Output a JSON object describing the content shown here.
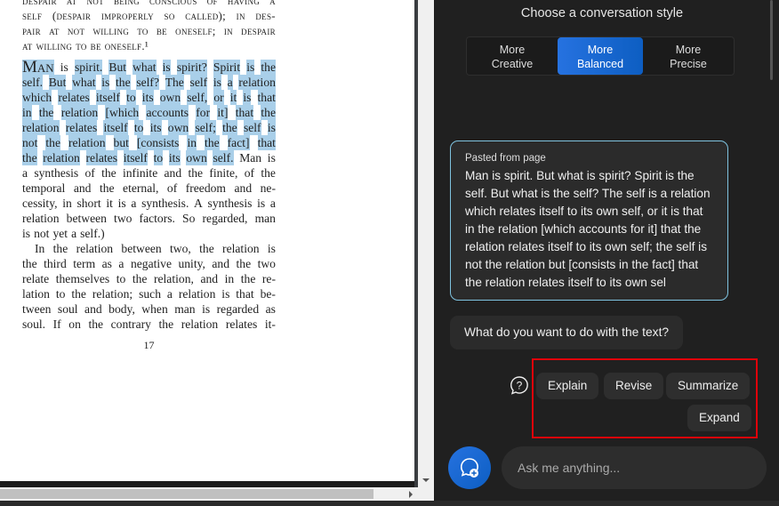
{
  "document": {
    "header_lines": [
      "despair at not being conscious of having a",
      "self (despair improperly so called); in des-",
      "pair at not willing to be oneself; in despair",
      "at willing to be oneself.¹"
    ],
    "para1": [
      [
        {
          "t": "Man",
          "hl": true,
          "cap": true
        },
        {
          "t": "is"
        },
        {
          "t": "spirit.",
          "hl": true
        },
        {
          "t": "But what is spirit? Spirit is the",
          "hl": true
        }
      ],
      [
        {
          "t": "self. But what is the self? The self is a relation",
          "hl": true
        }
      ],
      [
        {
          "t": "which relates itself to its own self, or it is that",
          "hl": true
        }
      ],
      [
        {
          "t": "in the relation [which accounts for it] that the",
          "hl": true
        }
      ],
      [
        {
          "t": "relation relates itself to its own self; the self is",
          "hl": true
        }
      ],
      [
        {
          "t": "not the relation but [consists in the fact] that",
          "hl": true
        }
      ],
      [
        {
          "t": "the relation relates itself to its own self.",
          "hl": true
        },
        {
          "t": "Man is"
        }
      ],
      [
        {
          "t": "a synthesis of the infinite and the finite, of the"
        }
      ],
      [
        {
          "t": "temporal and the eternal, of freedom and ne-"
        }
      ],
      [
        {
          "t": "cessity, in short it is a synthesis. A synthesis is a"
        }
      ],
      [
        {
          "t": "relation between two factors. So regarded, man"
        }
      ],
      [
        {
          "t": "is not yet a self.)"
        }
      ]
    ],
    "para2": [
      "In the relation between two, the relation is",
      "the third term as a negative unity, and the two",
      "relate themselves to the relation, and in the re-",
      "lation to the relation; such a relation is that be-",
      "tween soul and body, when man is regarded as",
      "soul. If on the contrary the relation relates it-"
    ],
    "page_number": "17"
  },
  "chat": {
    "style_title": "Choose a conversation style",
    "styles": [
      {
        "l1": "More",
        "l2": "Creative"
      },
      {
        "l1": "More",
        "l2": "Balanced",
        "selected": true
      },
      {
        "l1": "More",
        "l2": "Precise"
      }
    ],
    "pasted_label": "Pasted from page",
    "pasted_text": "Man is spirit. But what is spirit? Spirit is the self. But what is the self? The self is a relation which relates itself to its own self, or it is that in the relation [which accounts for it] that the relation relates itself to its own self; the self is not the relation but [consists in the fact] that the relation relates itself to its own sel",
    "question": "What do you want to do with the text?",
    "actions": {
      "explain": "Explain",
      "revise": "Revise",
      "summarize": "Summarize",
      "expand": "Expand"
    },
    "input_placeholder": "Ask me anything...",
    "accent": "#1a6ad8"
  }
}
